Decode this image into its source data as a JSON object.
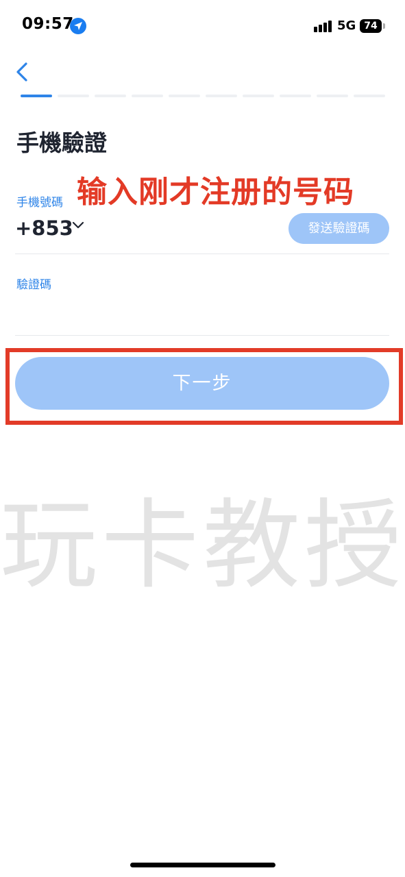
{
  "status_bar": {
    "time": "09:57",
    "network": "5G",
    "battery": "74"
  },
  "progress": {
    "total_steps": 10,
    "current_step": 1
  },
  "page": {
    "title": "手機驗證",
    "annotation": "输入刚才注册的号码"
  },
  "phone_field": {
    "label": "手機號碼",
    "country_code": "+853",
    "send_code_label": "發送驗證碼"
  },
  "code_field": {
    "label": "驗證碼",
    "value": ""
  },
  "next_button": {
    "label": "下一步"
  },
  "watermark": "玩卡教授",
  "colors": {
    "accent": "#2e84e8",
    "button_disabled": "#9ec5f8",
    "annotation": "#e33a26",
    "highlight_border": "#e23b28",
    "watermark": "#e3e3e3"
  },
  "icons": {
    "back": "chevron-left-icon",
    "location": "location-arrow-icon",
    "signal": "cellular-signal-icon",
    "battery": "battery-icon",
    "dropdown": "chevron-down-icon"
  }
}
